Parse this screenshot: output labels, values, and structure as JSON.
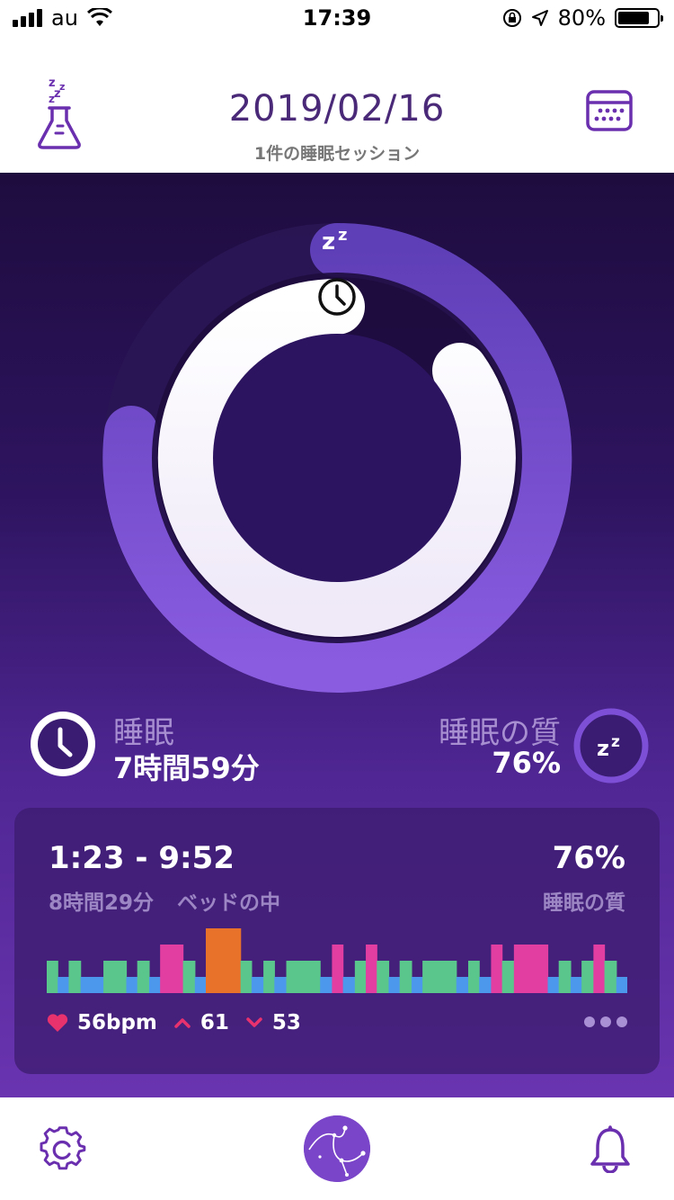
{
  "status_bar": {
    "carrier": "au",
    "time": "17:39",
    "battery": "80%"
  },
  "header": {
    "date": "2019/02/16",
    "sessions": "1件の睡眠セッション"
  },
  "summary": {
    "sleep_label": "睡眠",
    "sleep_value": "7時間59分",
    "quality_label": "睡眠の質",
    "quality_value": "76%"
  },
  "session": {
    "range": "1:23 - 9:52",
    "duration": "8時間29分",
    "in_bed": "ベッドの中",
    "quality_pct": "76%",
    "quality_label": "睡眠の質",
    "heart_rate": "56bpm",
    "hr_max": "61",
    "hr_min": "53",
    "stage_colors": {
      "deep": "#4b98ec",
      "light": "#5bc68c",
      "rem": "#e23da1",
      "awake": "#e8722a"
    }
  },
  "icons": {
    "lab": "flask-zzz-icon",
    "calendar": "calendar-icon",
    "clock": "clock-icon",
    "zzz": "zzz-icon",
    "settings": "gear-icon",
    "constellation": "constellation-icon",
    "alarm": "bell-icon"
  }
}
